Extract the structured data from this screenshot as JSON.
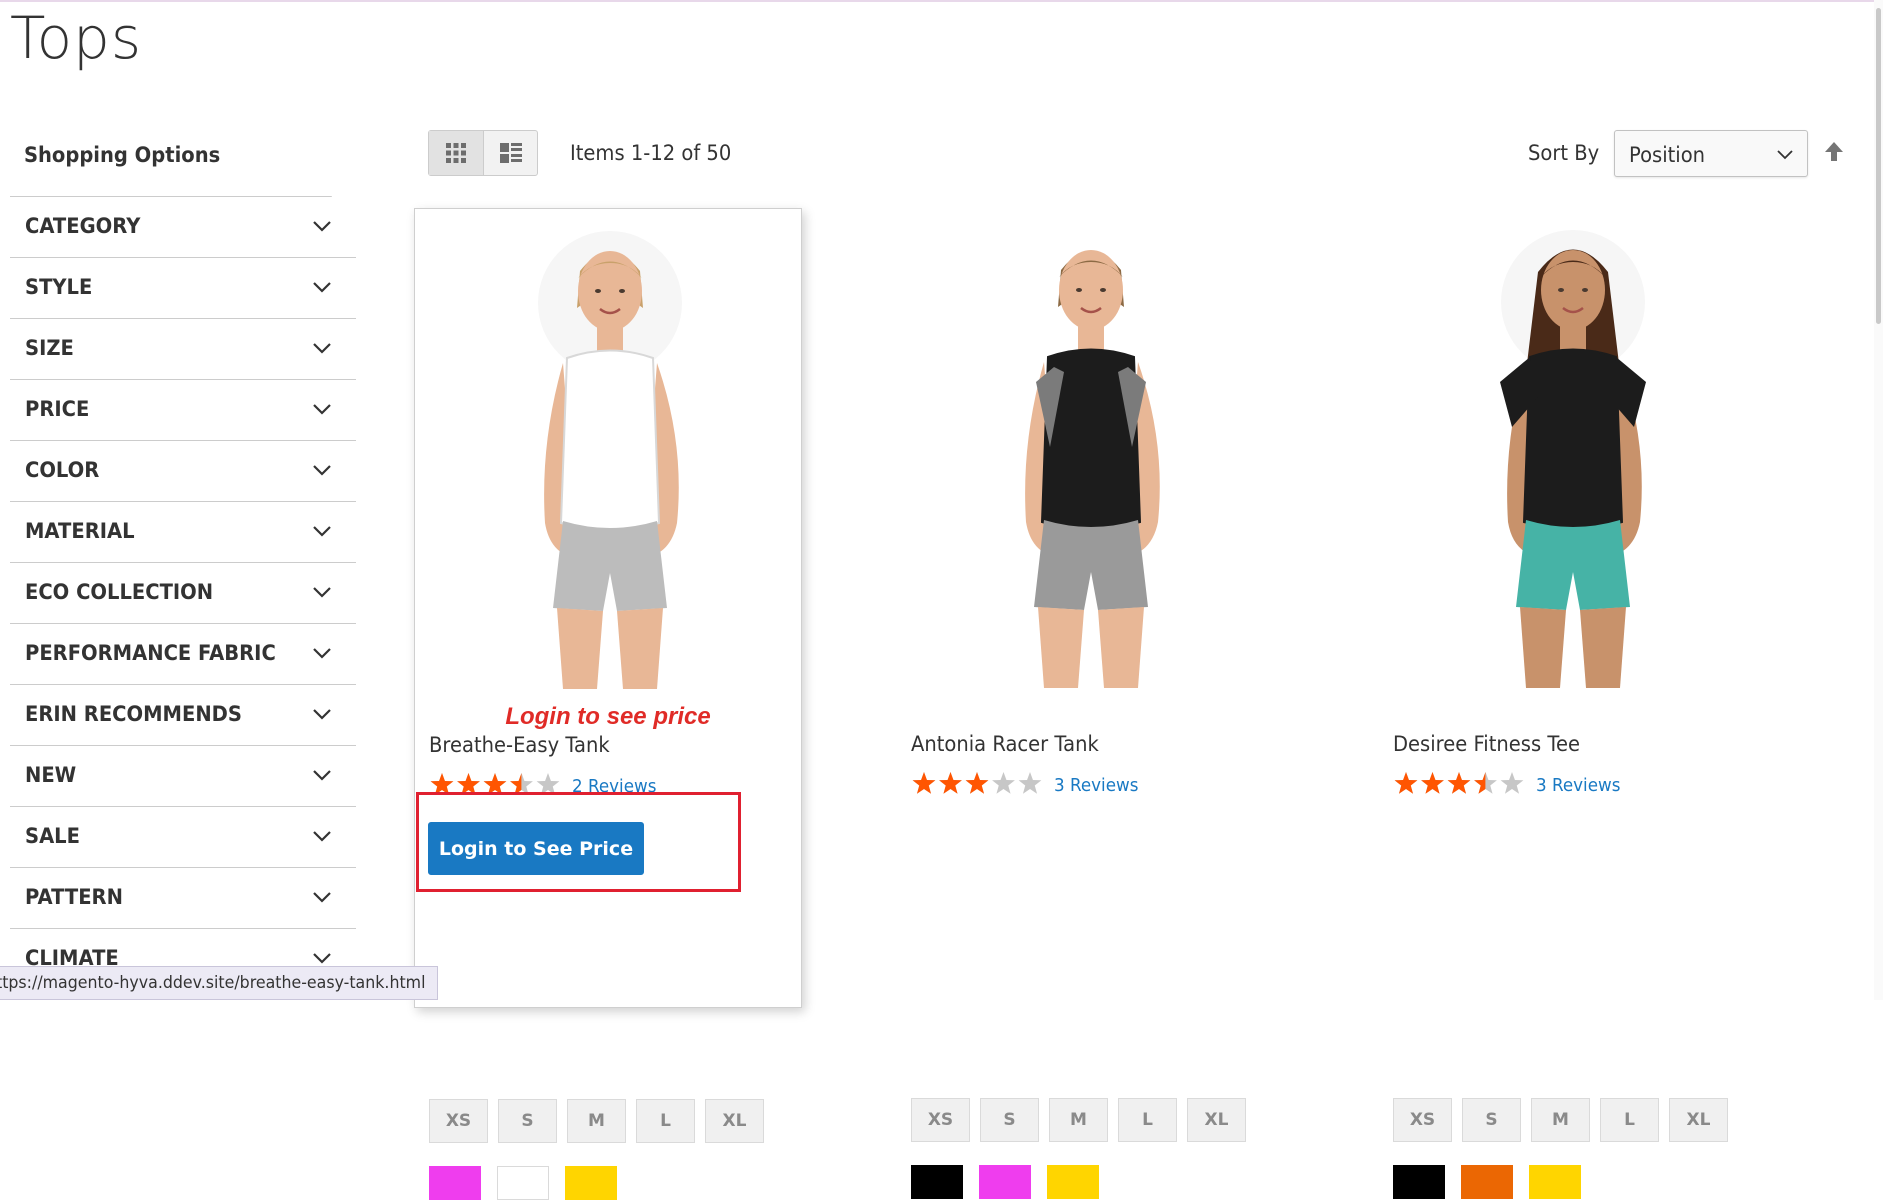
{
  "page": {
    "title": "Tops"
  },
  "sidebar": {
    "title": "Shopping Options",
    "filters": [
      {
        "label": "CATEGORY"
      },
      {
        "label": "STYLE"
      },
      {
        "label": "SIZE"
      },
      {
        "label": "PRICE"
      },
      {
        "label": "COLOR"
      },
      {
        "label": "MATERIAL"
      },
      {
        "label": "ECO COLLECTION"
      },
      {
        "label": "PERFORMANCE FABRIC"
      },
      {
        "label": "ERIN RECOMMENDS"
      },
      {
        "label": "NEW"
      },
      {
        "label": "SALE"
      },
      {
        "label": "PATTERN"
      },
      {
        "label": "CLIMATE"
      }
    ]
  },
  "toolbar": {
    "amount": "Items 1-12 of 50",
    "sort_label": "Sort By",
    "sort_value": "Position"
  },
  "products": [
    {
      "name": "Breathe-Easy Tank",
      "login_note": "Login to see price",
      "rating": 3.5,
      "reviews": "2  Reviews",
      "button": "Login to See Price",
      "sizes": [
        "XS",
        "S",
        "M",
        "L",
        "XL"
      ],
      "colors": [
        "#ef3dee",
        "#ffffff",
        "#ffd500"
      ]
    },
    {
      "name": "Antonia Racer Tank",
      "rating": 3,
      "reviews": "3  Reviews",
      "sizes": [
        "XS",
        "S",
        "M",
        "L",
        "XL"
      ],
      "colors": [
        "#000000",
        "#ef3dee",
        "#ffd500"
      ]
    },
    {
      "name": "Desiree Fitness Tee",
      "rating": 3.5,
      "reviews": "3  Reviews",
      "sizes": [
        "XS",
        "S",
        "M",
        "L",
        "XL"
      ],
      "colors": [
        "#000000",
        "#eb6703",
        "#ffd500"
      ]
    }
  ],
  "status_bar": {
    "url": "ttps://magento-hyva.ddev.site/breathe-easy-tank.html"
  },
  "colors": {
    "accent": "#1979c3",
    "star": "#ff5501",
    "star_empty": "#c7c7c7",
    "alert": "#e02b27"
  }
}
